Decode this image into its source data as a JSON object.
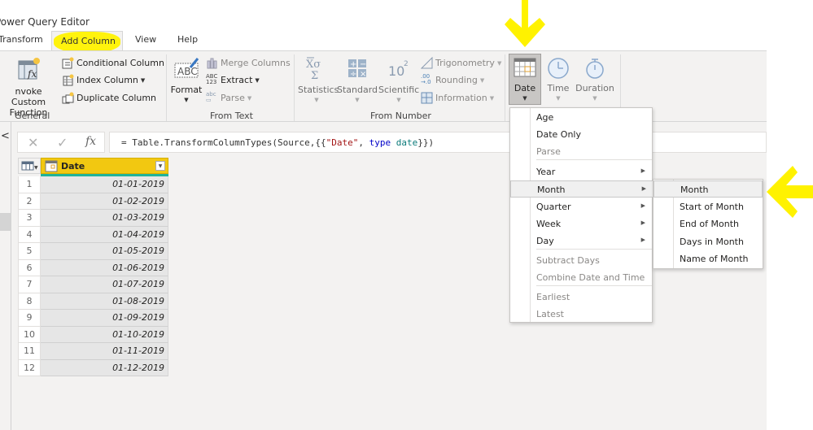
{
  "window": {
    "title": "Power Query Editor"
  },
  "tabs": [
    {
      "label": "Transform",
      "active": false
    },
    {
      "label": "Add Column",
      "active": true
    },
    {
      "label": "View",
      "active": false
    },
    {
      "label": "Help",
      "active": false
    }
  ],
  "ribbon": {
    "general": {
      "label": "General",
      "invoke_custom_function": "Invoke Custom Function",
      "invoke_line1": "nvoke Custom",
      "invoke_line2": "Function",
      "conditional_column": "Conditional Column",
      "index_column": "Index Column",
      "duplicate_column": "Duplicate Column"
    },
    "from_text": {
      "label": "From Text",
      "format": "Format",
      "merge_columns": "Merge Columns",
      "extract": "Extract",
      "parse": "Parse"
    },
    "from_number": {
      "label": "From Number",
      "statistics": "Statistics",
      "standard": "Standard",
      "scientific": "Scientific",
      "trigonometry": "Trigonometry",
      "rounding": "Rounding",
      "information": "Information"
    },
    "from_date_time": {
      "date": "Date",
      "time": "Time",
      "duration": "Duration"
    }
  },
  "formula_bar": {
    "prefix": "= Table.TransformColumnTypes(Source,{{",
    "str": "\"Date\"",
    "mid": ", ",
    "kw": "type",
    "sp": " ",
    "id": "date",
    "suffix": "}})"
  },
  "grid": {
    "column_header": "Date",
    "rows": [
      {
        "n": "1",
        "value": "01-01-2019"
      },
      {
        "n": "2",
        "value": "01-02-2019"
      },
      {
        "n": "3",
        "value": "01-03-2019"
      },
      {
        "n": "4",
        "value": "01-04-2019"
      },
      {
        "n": "5",
        "value": "01-05-2019"
      },
      {
        "n": "6",
        "value": "01-06-2019"
      },
      {
        "n": "7",
        "value": "01-07-2019"
      },
      {
        "n": "8",
        "value": "01-08-2019"
      },
      {
        "n": "9",
        "value": "01-09-2019"
      },
      {
        "n": "10",
        "value": "01-10-2019"
      },
      {
        "n": "11",
        "value": "01-11-2019"
      },
      {
        "n": "12",
        "value": "01-12-2019"
      }
    ]
  },
  "date_menu": {
    "items": [
      {
        "label": "Age",
        "disabled": false,
        "submenu": false
      },
      {
        "label": "Date Only",
        "disabled": false,
        "submenu": false
      },
      {
        "label": "Parse",
        "disabled": true,
        "submenu": false
      },
      {
        "label": "Year",
        "disabled": false,
        "submenu": true
      },
      {
        "label": "Month",
        "disabled": false,
        "submenu": true,
        "hover": true
      },
      {
        "label": "Quarter",
        "disabled": false,
        "submenu": true
      },
      {
        "label": "Week",
        "disabled": false,
        "submenu": true
      },
      {
        "label": "Day",
        "disabled": false,
        "submenu": true
      },
      {
        "label": "Subtract Days",
        "disabled": true,
        "submenu": false
      },
      {
        "label": "Combine Date and Time",
        "disabled": true,
        "submenu": false
      },
      {
        "label": "Earliest",
        "disabled": true,
        "submenu": false
      },
      {
        "label": "Latest",
        "disabled": true,
        "submenu": false
      }
    ]
  },
  "month_submenu": {
    "items": [
      {
        "label": "Month",
        "hover": true
      },
      {
        "label": "Start of Month"
      },
      {
        "label": "End of Month"
      },
      {
        "label": "Days in Month"
      },
      {
        "label": "Name of Month"
      }
    ]
  },
  "colors": {
    "highlight_annotation": "#fff200",
    "column_header": "#f2c811",
    "column_quality_bar": "#20b39a",
    "ribbon_bg": "#f3f2f1"
  }
}
